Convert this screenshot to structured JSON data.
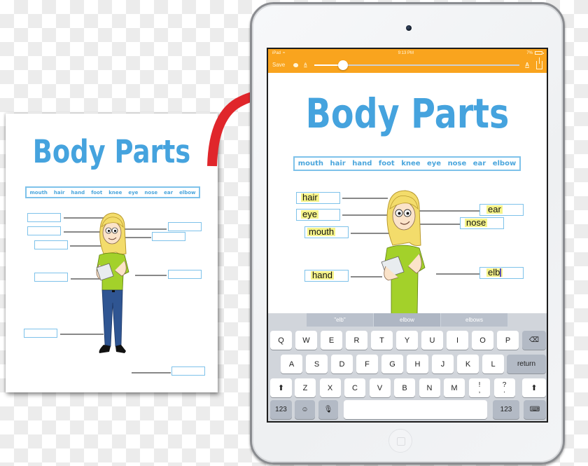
{
  "worksheet": {
    "title": "Body Parts",
    "word_bank": [
      "mouth",
      "hair",
      "hand",
      "foot",
      "knee",
      "eye",
      "nose",
      "ear",
      "elbow"
    ]
  },
  "ipad": {
    "status_bar": {
      "carrier": "iPad",
      "wifi_icon": "wifi-icon",
      "time": "9:13 PM",
      "battery": "7%"
    },
    "toolbar": {
      "save_label": "Save",
      "palette_icon": "palette-icon",
      "font_small_label": "A",
      "font_large_label": "A",
      "share_icon": "share-icon",
      "font_size_slider_value": 0.14
    },
    "document": {
      "title": "Body Parts",
      "word_bank": [
        "mouth",
        "hair",
        "hand",
        "foot",
        "knee",
        "eye",
        "nose",
        "ear",
        "elbow"
      ],
      "fields": [
        {
          "label": "hair"
        },
        {
          "label": "eye"
        },
        {
          "label": "mouth"
        },
        {
          "label": "hand"
        },
        {
          "label": "ear"
        },
        {
          "label": "nose"
        },
        {
          "label": "elb"
        }
      ]
    },
    "keyboard": {
      "suggestions": [
        "\"elb\"",
        "elbow",
        "elbows"
      ],
      "row1": [
        "Q",
        "W",
        "E",
        "R",
        "T",
        "Y",
        "U",
        "I",
        "O",
        "P"
      ],
      "row2": [
        "A",
        "S",
        "D",
        "F",
        "G",
        "H",
        "J",
        "K",
        "L"
      ],
      "row3": [
        "Z",
        "X",
        "C",
        "V",
        "B",
        "N",
        "M"
      ],
      "punct": [
        {
          "top": "!",
          "bottom": ","
        },
        {
          "top": "?",
          "bottom": "."
        }
      ],
      "return_label": "return",
      "numbers_label": "123",
      "delete_icon": "backspace-icon",
      "shift_icon": "shift-icon",
      "emoji_icon": "emoji-icon",
      "mic_icon": "microphone-icon",
      "hide_keyboard_icon": "hide-keyboard-icon"
    }
  }
}
